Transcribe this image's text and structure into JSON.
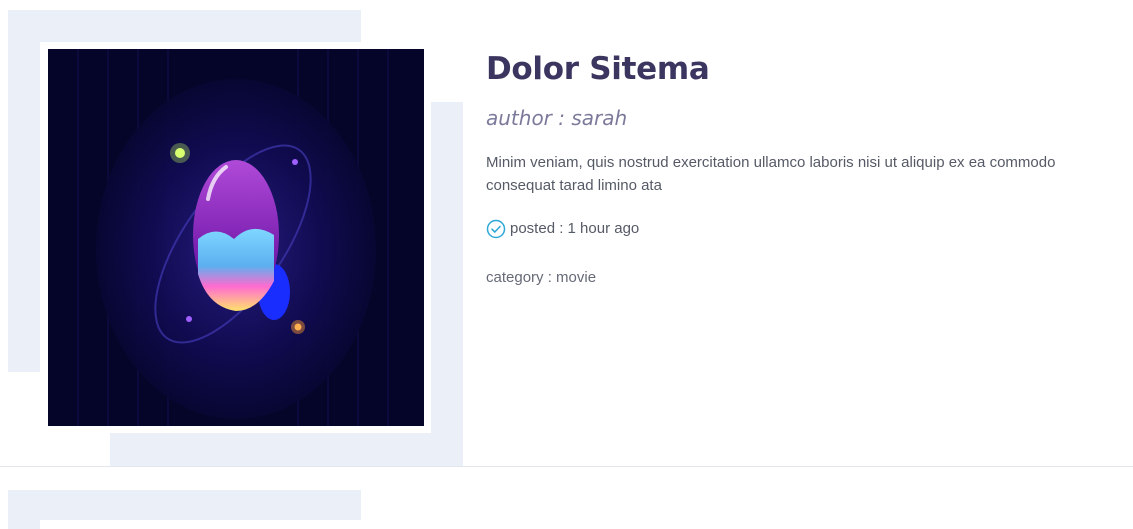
{
  "posts": [
    {
      "title": "Dolor Sitema",
      "author": "author : sarah",
      "excerpt": "Minim veniam, quis nostrud exercitation ullamco laboris nisi ut aliquip ex ea commodo consequat tarad limino ata",
      "posted": "posted : 1 hour ago",
      "category": "category : movie",
      "thumbnail_icon": "planet-illustration",
      "posted_icon": "check-circle-icon"
    }
  ],
  "colors": {
    "title": "#3a3660",
    "author": "#7b7a9b",
    "text": "#555a66",
    "accent": "#2fa8d8",
    "deco": "#ebeff8",
    "thumb_bg": "#05052a"
  }
}
